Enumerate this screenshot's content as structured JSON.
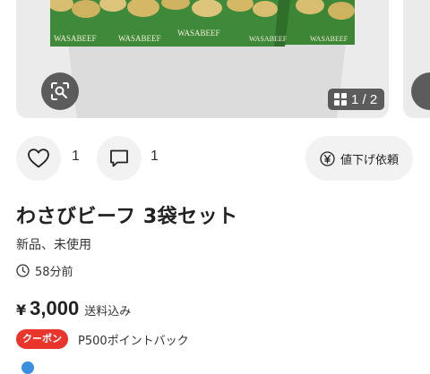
{
  "carousel": {
    "counter": "1 / 2",
    "photo_print": [
      "WASABEEF",
      "WASABEEF",
      "WASABEEF"
    ]
  },
  "actions": {
    "like_count": "1",
    "comment_count": "1",
    "price_down_label": "値下げ依頼"
  },
  "item": {
    "title": "わさびビーフ 3袋セット",
    "condition": "新品、未使用",
    "posted": "58分前",
    "currency": "¥",
    "price": "3,000",
    "shipping": "送料込み",
    "coupon_label": "クーポン",
    "point_back": "P500ポイントバック"
  },
  "colors": {
    "accent": "#ea352d",
    "package_green": "#3f8a3a",
    "chip": "#d8be70",
    "button_bg": "#f2f2f2",
    "overlay": "#3c3c3c"
  },
  "icons": [
    "scan-icon",
    "gallery-grid-icon",
    "heart-icon",
    "comment-icon",
    "yen-circle-icon",
    "clock-icon"
  ]
}
